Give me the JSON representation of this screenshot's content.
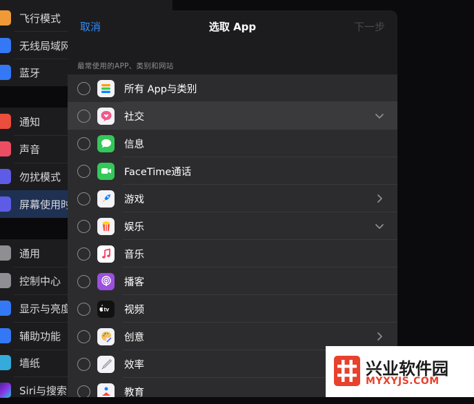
{
  "settings": {
    "items": [
      {
        "label": "飞行模式",
        "icon": "airplane-icon",
        "color": "#f09a37"
      },
      {
        "label": "无线局域网",
        "icon": "wifi-icon",
        "color": "#3478f6"
      },
      {
        "label": "蓝牙",
        "icon": "bluetooth-icon",
        "color": "#3478f6"
      },
      {
        "label": "通知",
        "icon": "notifications-icon",
        "color": "#eb4e3d"
      },
      {
        "label": "声音",
        "icon": "sounds-icon",
        "color": "#eb4d63"
      },
      {
        "label": "勿扰模式",
        "icon": "do-not-disturb-icon",
        "color": "#5e5ce6"
      },
      {
        "label": "屏幕使用时",
        "icon": "screen-time-icon",
        "color": "#5e5ce6"
      },
      {
        "label": "通用",
        "icon": "general-icon",
        "color": "#8e8e93"
      },
      {
        "label": "控制中心",
        "icon": "control-center-icon",
        "color": "#8e8e93"
      },
      {
        "label": "显示与亮度",
        "icon": "display-icon",
        "color": "#3478f6"
      },
      {
        "label": "辅助功能",
        "icon": "accessibility-icon",
        "color": "#3478f6"
      },
      {
        "label": "墙纸",
        "icon": "wallpaper-icon",
        "color": "#35aadc"
      },
      {
        "label": "Siri与搜索",
        "icon": "siri-icon",
        "color": "#2b2b2e"
      }
    ]
  },
  "sheet": {
    "cancel_label": "取消",
    "title": "选取 App",
    "next_label": "下一步",
    "section_header": "最常使用的APP、类别和网站",
    "rows": [
      {
        "label": "所有 App与类别",
        "icon": "all-apps-icon",
        "accessory": "none"
      },
      {
        "label": "社交",
        "icon": "social-icon",
        "accessory": "chevron-down"
      },
      {
        "label": "信息",
        "icon": "messages-icon",
        "accessory": "none"
      },
      {
        "label": "FaceTime通话",
        "icon": "facetime-icon",
        "accessory": "none"
      },
      {
        "label": "游戏",
        "icon": "games-icon",
        "accessory": "chevron-right"
      },
      {
        "label": "娱乐",
        "icon": "entertainment-icon",
        "accessory": "chevron-down"
      },
      {
        "label": "音乐",
        "icon": "music-icon",
        "accessory": "none"
      },
      {
        "label": "播客",
        "icon": "podcasts-icon",
        "accessory": "none"
      },
      {
        "label": "视频",
        "icon": "tv-icon",
        "accessory": "none"
      },
      {
        "label": "创意",
        "icon": "creativity-icon",
        "accessory": "chevron-right"
      },
      {
        "label": "效率",
        "icon": "productivity-icon",
        "accessory": "none"
      },
      {
        "label": "教育",
        "icon": "education-icon",
        "accessory": "none"
      }
    ]
  },
  "watermark": {
    "name": "兴业软件园",
    "url": "MYXYJS.COM"
  },
  "colors": {
    "accent": "#2f8cff",
    "sheet_bg": "#1c1c1e",
    "row_bg": "#2c2c2e",
    "watermark_red": "#e8412c"
  }
}
